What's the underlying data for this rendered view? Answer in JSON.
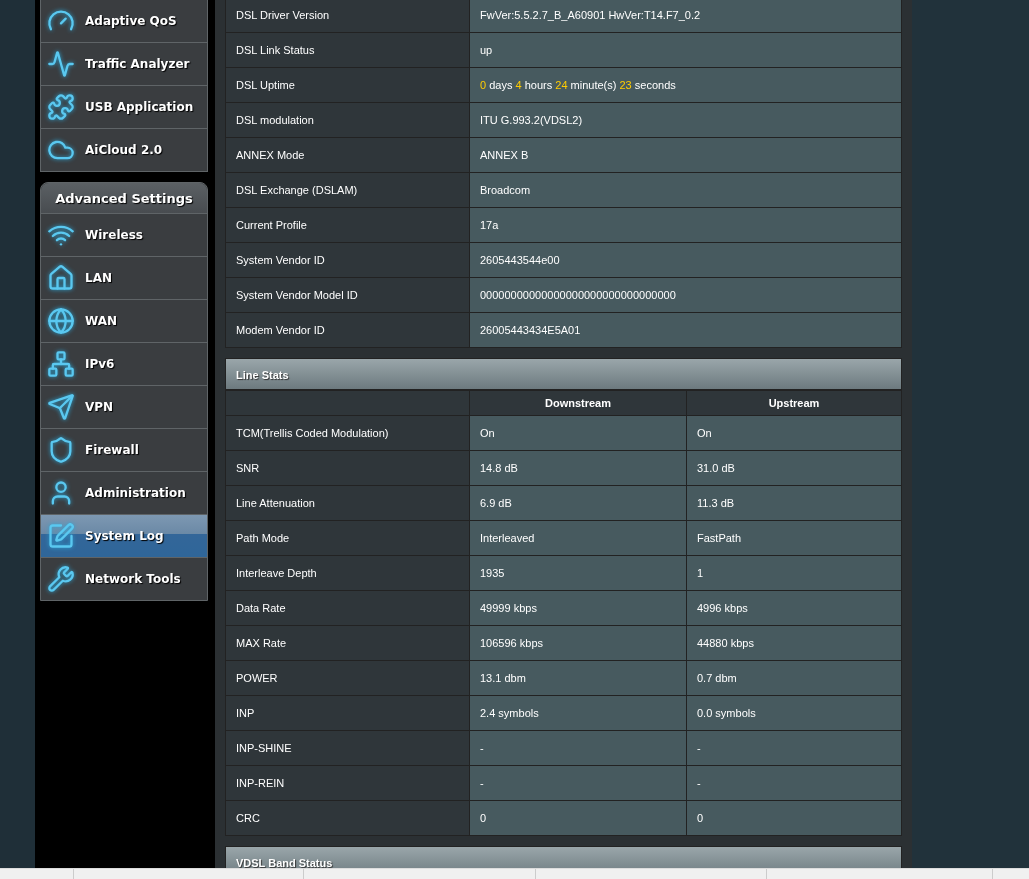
{
  "sidebar": {
    "top_items": [
      {
        "label": "Adaptive QoS",
        "selected": false
      },
      {
        "label": "Traffic Analyzer",
        "selected": false
      },
      {
        "label": "USB Application",
        "selected": false
      },
      {
        "label": "AiCloud 2.0",
        "selected": false
      }
    ],
    "advanced_title": "Advanced Settings",
    "advanced_items": [
      {
        "label": "Wireless",
        "selected": false
      },
      {
        "label": "LAN",
        "selected": false
      },
      {
        "label": "WAN",
        "selected": false
      },
      {
        "label": "IPv6",
        "selected": false
      },
      {
        "label": "VPN",
        "selected": false
      },
      {
        "label": "Firewall",
        "selected": false
      },
      {
        "label": "Administration",
        "selected": false
      },
      {
        "label": "System Log",
        "selected": true
      },
      {
        "label": "Network Tools",
        "selected": false
      }
    ]
  },
  "info_rows": [
    {
      "label": "DSL Driver Version",
      "value": [
        {
          "kind": "text",
          "text": "FwVer:5.5.2.7_B_A60901 HwVer:T14.F7_0.2"
        }
      ]
    },
    {
      "label": "DSL Link Status",
      "value": [
        {
          "kind": "text",
          "text": "up"
        }
      ]
    },
    {
      "label": "DSL Uptime",
      "value": [
        {
          "kind": "number",
          "text": "0"
        },
        {
          "kind": "text",
          "text": "days"
        },
        {
          "kind": "number",
          "text": "4"
        },
        {
          "kind": "text",
          "text": "hours"
        },
        {
          "kind": "number",
          "text": "24"
        },
        {
          "kind": "text",
          "text": "minute(s)"
        },
        {
          "kind": "number",
          "text": "23"
        },
        {
          "kind": "text",
          "text": "seconds"
        }
      ]
    },
    {
      "label": "DSL modulation",
      "value": [
        {
          "kind": "text",
          "text": "ITU G.993.2(VDSL2)"
        }
      ]
    },
    {
      "label": "ANNEX Mode",
      "value": [
        {
          "kind": "text",
          "text": "ANNEX B"
        }
      ]
    },
    {
      "label": "DSL Exchange (DSLAM)",
      "value": [
        {
          "kind": "text",
          "text": "Broadcom"
        }
      ]
    },
    {
      "label": "Current Profile",
      "value": [
        {
          "kind": "text",
          "text": "17a"
        }
      ]
    },
    {
      "label": "System Vendor ID",
      "value": [
        {
          "kind": "text",
          "text": "2605443544e00"
        }
      ]
    },
    {
      "label": "System Vendor Model ID",
      "value": [
        {
          "kind": "text",
          "text": "00000000000000000000000000000000"
        }
      ]
    },
    {
      "label": "Modem Vendor ID",
      "value": [
        {
          "kind": "text",
          "text": "26005443434E5A01"
        }
      ]
    }
  ],
  "line_stats": {
    "title": "Line Stats",
    "columns": [
      "Downstream",
      "Upstream"
    ],
    "rows": [
      {
        "label": "TCM(Trellis Coded Modulation)",
        "downstream": "On",
        "upstream": "On"
      },
      {
        "label": "SNR",
        "downstream": "14.8 dB",
        "upstream": "31.0 dB"
      },
      {
        "label": "Line Attenuation",
        "downstream": "6.9 dB",
        "upstream": "11.3 dB"
      },
      {
        "label": "Path Mode",
        "downstream": "Interleaved",
        "upstream": "FastPath"
      },
      {
        "label": "Interleave Depth",
        "downstream": "1935",
        "upstream": "1"
      },
      {
        "label": "Data Rate",
        "downstream": "49999 kbps",
        "upstream": "4996 kbps"
      },
      {
        "label": "MAX Rate",
        "downstream": "106596 kbps",
        "upstream": "44880 kbps"
      },
      {
        "label": "POWER",
        "downstream": "13.1 dbm",
        "upstream": "0.7 dbm"
      },
      {
        "label": "INP",
        "downstream": "2.4 symbols",
        "upstream": "0.0 symbols"
      },
      {
        "label": "INP-SHINE",
        "downstream": "-",
        "upstream": "-"
      },
      {
        "label": "INP-REIN",
        "downstream": "-",
        "upstream": "-"
      },
      {
        "label": "CRC",
        "downstream": "0",
        "upstream": "0"
      }
    ]
  },
  "vdsl_band": {
    "title": "VDSL Band Status"
  }
}
